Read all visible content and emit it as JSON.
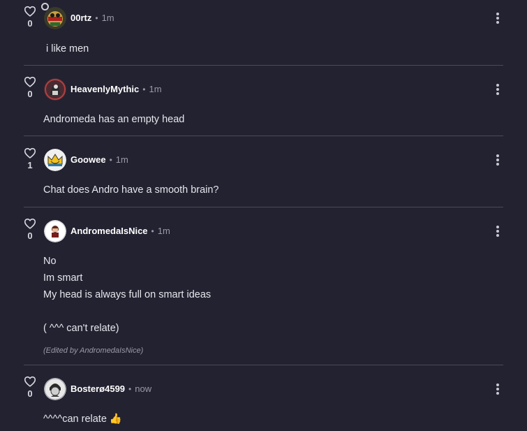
{
  "comments": [
    {
      "username": "00rtz",
      "time": "1m",
      "likes": "0",
      "lines": [
        "i like men"
      ]
    },
    {
      "username": "HeavenlyMythic",
      "time": "1m",
      "likes": "0",
      "lines": [
        "Andromeda has an empty head"
      ]
    },
    {
      "username": "Goowee",
      "time": "1m",
      "likes": "1",
      "lines": [
        "Chat does Andro have a smooth brain?"
      ]
    },
    {
      "username": "AndromedaIsNice",
      "time": "1m",
      "likes": "0",
      "lines": [
        "No",
        "Im smart",
        "My head is always full on smart ideas",
        "",
        "( ^^^ can't relate)"
      ],
      "edited": "(Edited by AndromedaIsNice)"
    },
    {
      "username": "Bosterø4599",
      "time": "now",
      "likes": "0",
      "lines": [
        "^^^^can relate 👍"
      ]
    }
  ],
  "separator": "•",
  "colors": {
    "background": "#232231",
    "divider": "#4a4a5a",
    "muted": "#9a9aa8"
  }
}
